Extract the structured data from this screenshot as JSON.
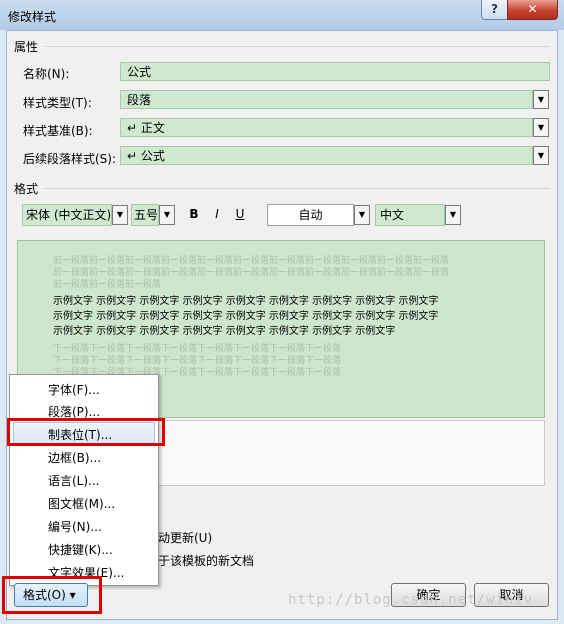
{
  "window": {
    "title": "修改样式",
    "help": "?",
    "close": "✕"
  },
  "properties": {
    "heading": "属性",
    "name_label": "名称(N):",
    "name_value": "公式",
    "type_label": "样式类型(T):",
    "type_value": "段落",
    "based_label": "样式基准(B):",
    "based_value": "↵ 正文",
    "next_label": "后续段落样式(S):",
    "next_value": "↵ 公式"
  },
  "format": {
    "heading": "格式",
    "font": "宋体 (中文正文)",
    "size": "五号",
    "bold": "B",
    "italic": "I",
    "underline": "U",
    "color": "自动",
    "language": "中文"
  },
  "preview": {
    "prev_line1": "前一段落前一段落前一段落前一段落前一段落前一段落前一段落前一段落前一段落前一段落前一段落",
    "prev_line2": "前一段落前一段落前一段落",
    "sample_line1": "示例文字 示例文字 示例文字 示例文字 示例文字 示例文字 示例文字 示例文字 示例文字",
    "sample_line2": "示例文字 示例文字 示例文字 示例文字 示例文字 示例文字 示例文字 示例文字 示例文字",
    "sample_line3": "示例文字 示例文字 示例文字 示例文字 示例文字 示例文字 示例文字 示例文字",
    "next_line1": "下一段落下一段落下一段落下一段落下一段落下一段落下一段落下一段落",
    "next_line2": "下一段落下一段落下一段落下一段落下一段落下一段落下一段落下一段落",
    "next_line3": "下一段落下一段落下一段落下一段落下一段落下一段落下一段落下一段落"
  },
  "options": {
    "auto_update": "动更新(U)",
    "new_docs": "于该模板的新文档"
  },
  "menu": {
    "items": [
      "字体(F)...",
      "段落(P)...",
      "制表位(T)...",
      "边框(B)...",
      "语言(L)...",
      "图文框(M)...",
      "编号(N)...",
      "快捷键(K)...",
      "文字效果(E)..."
    ]
  },
  "buttons": {
    "format": "格式(O) ▾",
    "ok": "确定",
    "cancel": "取消"
  },
  "watermark": "http://blog.csdn.net/winiv",
  "colors": {
    "field_bg": "#cfe8cf",
    "highlight_red": "#e00000",
    "titlebar": "#b3cbe6"
  }
}
